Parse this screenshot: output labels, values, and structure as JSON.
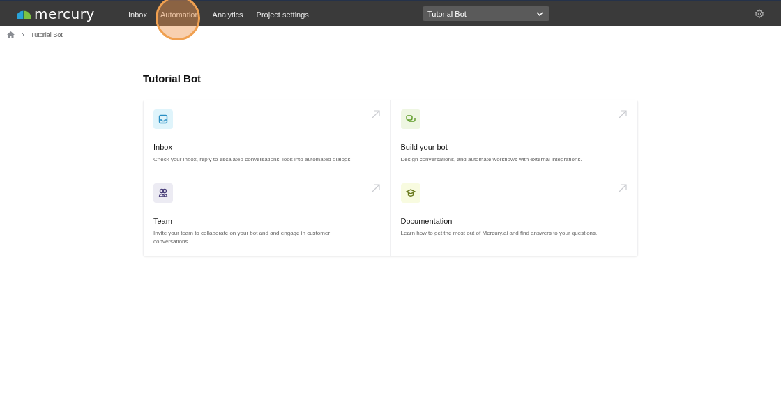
{
  "brand": {
    "name": "mercury"
  },
  "nav": [
    {
      "label": "Inbox",
      "highlighted": false
    },
    {
      "label": "Automation",
      "highlighted": true
    },
    {
      "label": "Analytics",
      "highlighted": false
    },
    {
      "label": "Project settings",
      "highlighted": false
    }
  ],
  "project_select": {
    "value": "Tutorial Bot"
  },
  "breadcrumb": [
    "Tutorial Bot"
  ],
  "page_title": "Tutorial Bot",
  "cards": [
    {
      "kind": "inbox",
      "color": "#dff4fb",
      "title": "Inbox",
      "description": "Check your inbox, reply to escalated conversations, look into automated dialogs."
    },
    {
      "kind": "chat",
      "color": "#eef6e2",
      "title": "Build your bot",
      "description": "Design conversations, and automate workflows with external integrations."
    },
    {
      "kind": "team",
      "color": "#ecebf3",
      "title": "Team",
      "description": "Invite your team to collaborate on your bot and and engage in customer conversations."
    },
    {
      "kind": "docs",
      "color": "#f8fbe0",
      "title": "Documentation",
      "description": "Learn how to get the most out of Mercury.ai and find answers to your questions."
    }
  ]
}
